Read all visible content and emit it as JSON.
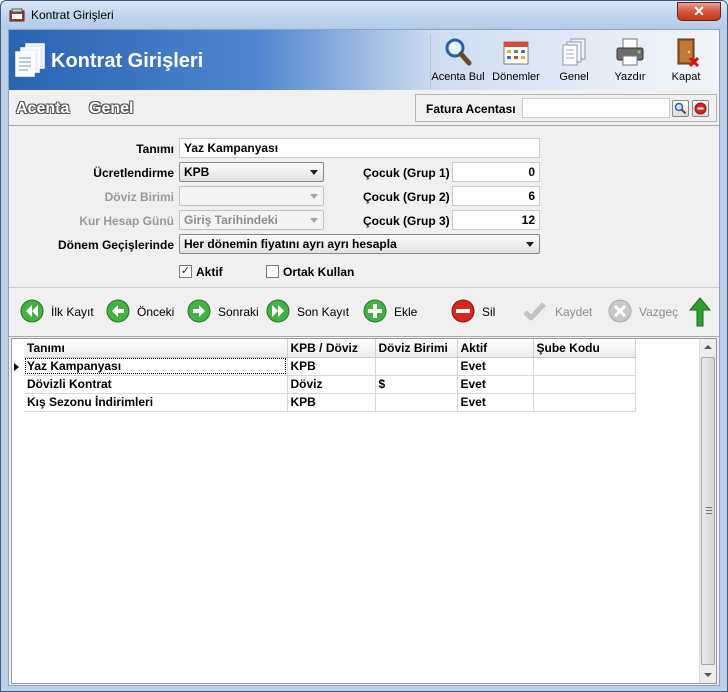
{
  "window": {
    "title": "Kontrat Girişleri",
    "close_label": "✕"
  },
  "banner": {
    "title": "Kontrat Girişleri"
  },
  "toolbar": {
    "acenta_bul": "Acenta Bul",
    "donemler": "Dönemler",
    "genel": "Genel",
    "yazdir": "Yazdır",
    "kapat": "Kapat"
  },
  "tabs": {
    "acenta": "Acenta",
    "genel": "Genel"
  },
  "fatura": {
    "label": "Fatura Acentası",
    "value": ""
  },
  "form": {
    "tanimi_label": "Tanımı",
    "tanimi_value": "Yaz Kampanyası",
    "ucretlendirme_label": "Ücretlendirme",
    "ucretlendirme_value": "KPB",
    "doviz_birimi_label": "Döviz Birimi",
    "doviz_birimi_value": "",
    "kur_hesap_label": "Kur Hesap Günü",
    "kur_hesap_value": "Giriş Tarihindeki",
    "donem_label": "Dönem Geçişlerinde",
    "donem_value": "Her dönemin fiyatını ayrı ayrı hesapla",
    "cocuk1_label": "Çocuk (Grup 1)",
    "cocuk1_value": "0",
    "cocuk2_label": "Çocuk (Grup 2)",
    "cocuk2_value": "6",
    "cocuk3_label": "Çocuk (Grup 3)",
    "cocuk3_value": "12",
    "aktif_label": "Aktif",
    "aktif_checked": true,
    "ortak_label": "Ortak Kullan",
    "ortak_checked": false
  },
  "nav": {
    "ilk": "İlk Kayıt",
    "onceki": "Önceki",
    "sonraki": "Sonraki",
    "son": "Son Kayıt",
    "ekle": "Ekle",
    "sil": "Sil",
    "kaydet": "Kaydet",
    "vazgec": "Vazgeç"
  },
  "grid": {
    "columns": [
      "Tanımı",
      "KPB / Döviz",
      "Döviz Birimi",
      "Aktif",
      "Şube Kodu"
    ],
    "rows": [
      [
        "Yaz Kampanyası",
        "KPB",
        "",
        "Evet",
        ""
      ],
      [
        "Dövizli Kontrat",
        "Döviz",
        "$",
        "Evet",
        ""
      ],
      [
        "Kış Sezonu İndirimleri",
        "KPB",
        "",
        "Evet",
        ""
      ]
    ]
  },
  "colors": {
    "banner_blue": "#2a63b2",
    "green_nav": "#3aa53a",
    "red_delete": "#d9261c"
  }
}
